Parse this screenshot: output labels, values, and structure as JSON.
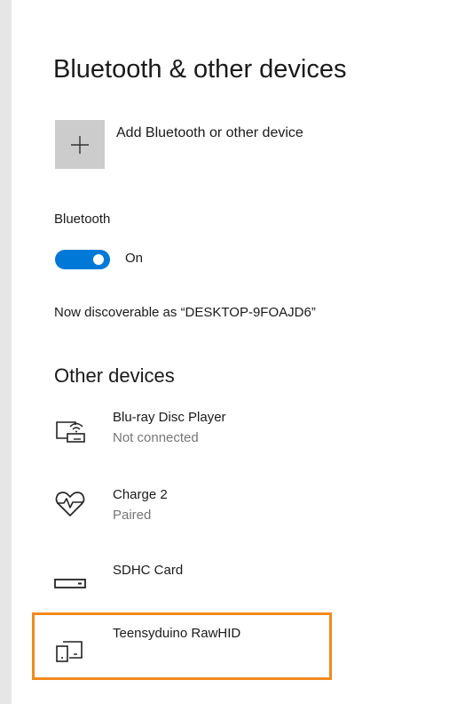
{
  "page": {
    "title": "Bluetooth & other devices"
  },
  "add_device": {
    "label": "Add Bluetooth or other device",
    "icon": "plus-icon"
  },
  "bluetooth": {
    "label": "Bluetooth",
    "toggle_state": "On",
    "enabled": true,
    "accent_color": "#0078d7"
  },
  "discoverable_text": "Now discoverable as “DESKTOP-9FOAJD6”",
  "other_devices": {
    "title": "Other devices",
    "items": [
      {
        "name": "Blu-ray Disc Player",
        "status": "Not connected",
        "icon": "media-player-icon"
      },
      {
        "name": "Charge 2",
        "status": "Paired",
        "icon": "heart-rate-icon"
      },
      {
        "name": "SDHC Card",
        "status": "",
        "icon": "card-reader-icon"
      },
      {
        "name": "Teensyduino RawHID",
        "status": "",
        "icon": "devices-icon",
        "highlighted": true
      }
    ]
  },
  "colors": {
    "highlight_border": "#f28a1d",
    "secondary_text": "#767676"
  }
}
